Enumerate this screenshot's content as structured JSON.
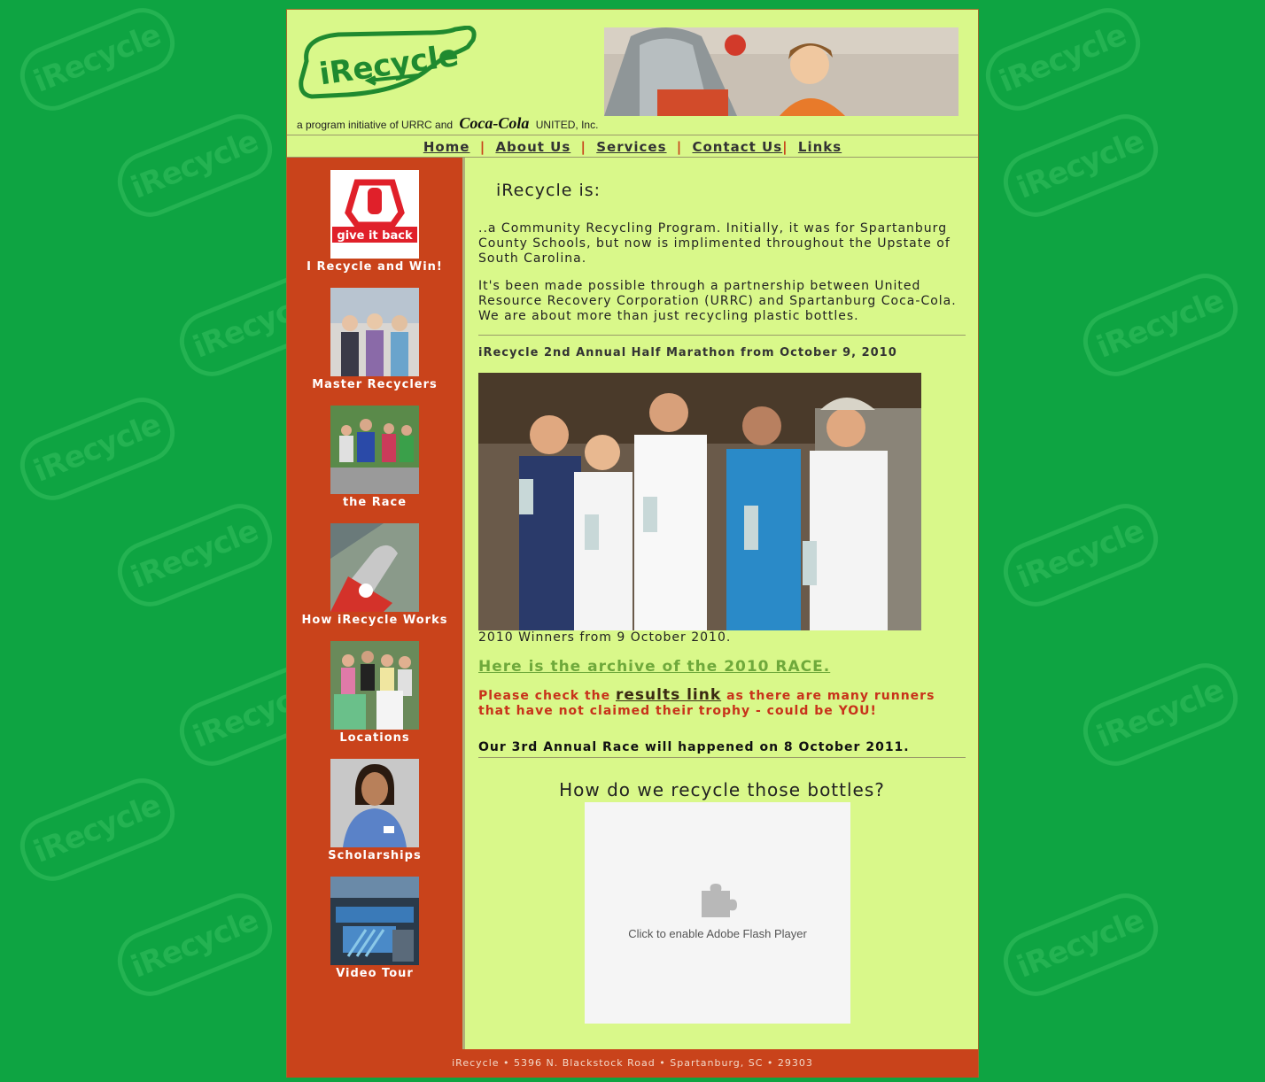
{
  "header": {
    "tagline_prefix": "a program initiative of URRC and",
    "tagline_brand": "Coca-Cola",
    "tagline_suffix": "UNITED, Inc.",
    "logo_text": "iRecycle"
  },
  "nav": {
    "items": [
      {
        "label": "Home"
      },
      {
        "label": "About Us"
      },
      {
        "label": "Services"
      },
      {
        "label": "Contact Us"
      },
      {
        "label": "Links"
      }
    ],
    "separator": "|"
  },
  "sidebar": {
    "items": [
      {
        "label": "I Recycle and Win!",
        "thumb_text": "give it back"
      },
      {
        "label": "Master Recyclers"
      },
      {
        "label": "the Race"
      },
      {
        "label": "How iRecycle Works"
      },
      {
        "label": "Locations"
      },
      {
        "label": "Scholarships"
      },
      {
        "label": "Video Tour"
      }
    ]
  },
  "main": {
    "title": "iRecycle is:",
    "para1": "..a Community Recycling Program. Initially, it was for Spartanburg County Schools, but now is implimented throughout the Upstate of South Carolina.",
    "para2": "It's been made possible through a partnership between United Resource Recovery Corporation (URRC) and Spartanburg Coca-Cola. We are about more than just recycling plastic bottles.",
    "race_heading": "iRecycle 2nd Annual Half Marathon from October 9, 2010",
    "caption": "2010 Winners from 9 October 2010.",
    "archive_link": "Here is the archive of the 2010 RACE.",
    "notice_before": "Please check the",
    "notice_link": "results link",
    "notice_after": "as there are many runners that have not claimed their trophy - could be YOU!",
    "race_3rd": "Our 3rd Annual Race will happened on 8 October 2011.",
    "recycle_question": "How do we recycle those bottles?",
    "flash_text": "Click to enable Adobe Flash Player"
  },
  "footer": {
    "text": "iRecycle • 5396 N. Blackstock Road • Spartanburg, SC • 29303"
  },
  "colors": {
    "background": "#0ea442",
    "page": "#d9f88a",
    "sidebar": "#c9431b",
    "notice": "#c8321a",
    "archive_link": "#6fa93b"
  }
}
